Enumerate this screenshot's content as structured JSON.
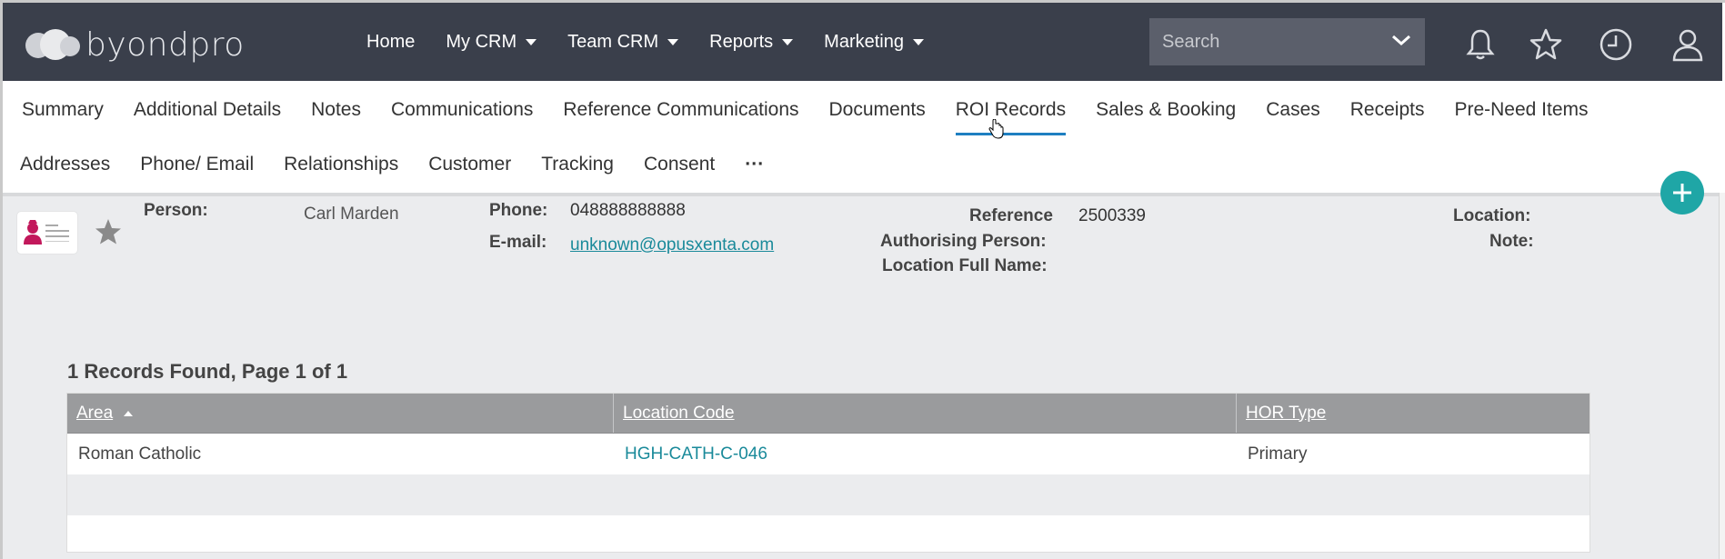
{
  "header": {
    "brand": "byondpro",
    "nav": [
      {
        "label": "Home",
        "dropdown": false
      },
      {
        "label": "My CRM",
        "dropdown": true
      },
      {
        "label": "Team CRM",
        "dropdown": true
      },
      {
        "label": "Reports",
        "dropdown": true
      },
      {
        "label": "Marketing",
        "dropdown": true
      }
    ],
    "search_placeholder": "Search",
    "icons": [
      "bell-icon",
      "star-icon",
      "clock-icon",
      "user-icon"
    ]
  },
  "tabs_row1": [
    {
      "label": "Summary"
    },
    {
      "label": "Additional Details"
    },
    {
      "label": "Notes"
    },
    {
      "label": "Communications"
    },
    {
      "label": "Reference Communications"
    },
    {
      "label": "Documents"
    },
    {
      "label": "ROI Records",
      "active": true
    },
    {
      "label": "Sales & Booking"
    },
    {
      "label": "Cases"
    },
    {
      "label": "Receipts"
    },
    {
      "label": "Pre-Need Items"
    }
  ],
  "tabs_row2": [
    {
      "label": "Addresses"
    },
    {
      "label": "Phone/ Email"
    },
    {
      "label": "Relationships"
    },
    {
      "label": "Customer"
    },
    {
      "label": "Tracking"
    },
    {
      "label": "Consent"
    },
    {
      "label": "···"
    }
  ],
  "summary": {
    "person_label": "Person:",
    "person_value": "Carl Marden",
    "phone_label": "Phone:",
    "phone_value": "048888888888",
    "email_label": "E-mail:",
    "email_value": "unknown@opusxenta.com",
    "reference_label": "Reference",
    "reference_value": "2500339",
    "authorising_label": "Authorising Person:",
    "location_full_label": "Location Full Name:",
    "location_label": "Location:",
    "note_label": "Note:"
  },
  "records": {
    "summary_text": "1 Records Found, Page 1 of 1",
    "columns": [
      "Area",
      "Location Code",
      "HOR Type"
    ],
    "rows": [
      [
        "Roman Catholic",
        "HGH-CATH-C-046",
        "Primary"
      ]
    ]
  },
  "colors": {
    "topbar": "#3a3f4b",
    "accent_tab": "#1e7fc1",
    "fab": "#1fa6a6",
    "link": "#1a8a9a"
  }
}
